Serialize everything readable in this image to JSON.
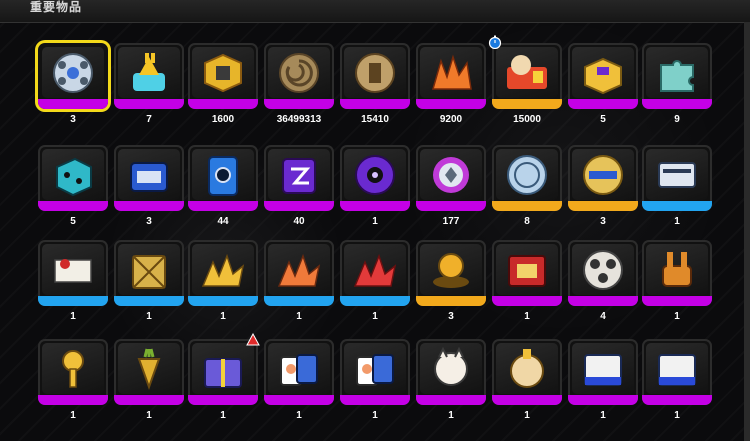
{
  "header": {
    "title": "重要物品"
  },
  "colors": {
    "selected_border": "#f3d91a",
    "rarity_purple": "#c400e6",
    "rarity_gold": "#f2a91c",
    "rarity_blue": "#22a4f0"
  },
  "items": [
    {
      "count": "3",
      "rarity": "purple",
      "icon": "film-reel-disc-icon",
      "selected": true
    },
    {
      "count": "7",
      "rarity": "purple",
      "icon": "bunny-ticket-booth-icon"
    },
    {
      "count": "1600",
      "rarity": "purple",
      "icon": "gold-cube-icon"
    },
    {
      "count": "36499313",
      "rarity": "purple",
      "icon": "spiral-coin-icon"
    },
    {
      "count": "15410",
      "rarity": "purple",
      "icon": "bronze-coin-icon"
    },
    {
      "count": "9200",
      "rarity": "purple",
      "icon": "orange-crystal-icon"
    },
    {
      "count": "15000",
      "rarity": "gold",
      "icon": "bunny-ticket-icon",
      "timed": true
    },
    {
      "count": "5",
      "rarity": "purple",
      "icon": "gold-toolbox-icon"
    },
    {
      "count": "9",
      "rarity": "purple",
      "icon": "puzzle-piece-icon"
    },
    {
      "count": "5",
      "rarity": "purple",
      "icon": "teal-dice-icon"
    },
    {
      "count": "3",
      "rarity": "purple",
      "icon": "blue-box-icon"
    },
    {
      "count": "44",
      "rarity": "purple",
      "icon": "blue-card-icon"
    },
    {
      "count": "40",
      "rarity": "purple",
      "icon": "purple-card-icon"
    },
    {
      "count": "1",
      "rarity": "purple",
      "icon": "purple-record-icon"
    },
    {
      "count": "177",
      "rarity": "purple",
      "icon": "gear-badge-icon"
    },
    {
      "count": "8",
      "rarity": "gold",
      "icon": "silver-medal-icon"
    },
    {
      "count": "3",
      "rarity": "gold",
      "icon": "gold-medal-icon"
    },
    {
      "count": "1",
      "rarity": "blue",
      "icon": "ticket-stack-icon"
    },
    {
      "count": "1",
      "rarity": "blue",
      "icon": "letter-envelope-icon"
    },
    {
      "count": "1",
      "rarity": "blue",
      "icon": "gold-crate-icon"
    },
    {
      "count": "1",
      "rarity": "blue",
      "icon": "gold-shard-icon"
    },
    {
      "count": "1",
      "rarity": "blue",
      "icon": "orange-shard-icon"
    },
    {
      "count": "1",
      "rarity": "blue",
      "icon": "red-shard-icon"
    },
    {
      "count": "3",
      "rarity": "gold",
      "icon": "gold-bear-statue-icon"
    },
    {
      "count": "1",
      "rarity": "purple",
      "icon": "red-scroll-icon"
    },
    {
      "count": "4",
      "rarity": "purple",
      "icon": "film-reel-icon"
    },
    {
      "count": "1",
      "rarity": "purple",
      "icon": "bunny-robot-icon"
    },
    {
      "count": "1",
      "rarity": "purple",
      "icon": "gold-key-icon"
    },
    {
      "count": "1",
      "rarity": "purple",
      "icon": "gold-carrot-icon"
    },
    {
      "count": "1",
      "rarity": "purple",
      "icon": "gift-box-icon",
      "tagged": true
    },
    {
      "count": "1",
      "rarity": "purple",
      "icon": "cat-cards-icon"
    },
    {
      "count": "1",
      "rarity": "purple",
      "icon": "cat-cards-icon"
    },
    {
      "count": "1",
      "rarity": "purple",
      "icon": "white-cat-icon"
    },
    {
      "count": "1",
      "rarity": "purple",
      "icon": "lucky-cat-icon"
    },
    {
      "count": "1",
      "rarity": "purple",
      "icon": "tiger-card-icon"
    },
    {
      "count": "1",
      "rarity": "purple",
      "icon": "tiger-card-icon"
    }
  ]
}
